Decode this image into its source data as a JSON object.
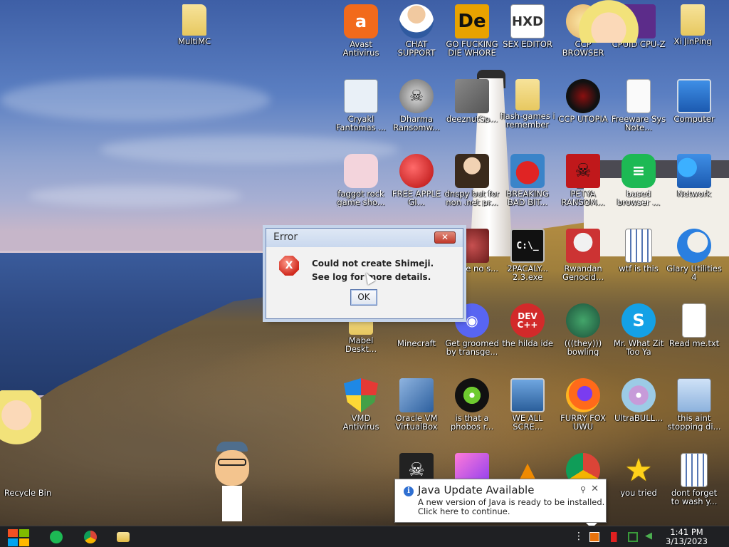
{
  "desktop": {
    "icons": [
      {
        "label": "MultiMC",
        "icon": "folder-icon"
      },
      {
        "label": "Avast Antivirus",
        "icon": "avast-icon"
      },
      {
        "label": "CHAT SUPPORT",
        "icon": "doctor-icon"
      },
      {
        "label": "GO FUCKING DIE WHORE",
        "icon": "dependency-walker-icon"
      },
      {
        "label": "SEX EDITOR",
        "icon": "hxd-icon"
      },
      {
        "label": "CCP BROWSER",
        "icon": "browser-icon"
      },
      {
        "label": "CPUID CPU-Z",
        "icon": "cpuz-icon"
      },
      {
        "label": "Xi JinPing",
        "icon": "user-folder-icon"
      },
      {
        "label": "Cryakl Fantomas ...",
        "icon": "window-icon"
      },
      {
        "label": "Dharma Ransomw...",
        "icon": "skull-icon"
      },
      {
        "label": "deeznutSp...",
        "icon": "stacked-windows-icon"
      },
      {
        "label": "flash-games i remember",
        "icon": "folder-icon"
      },
      {
        "label": "CCP UTOPIA",
        "icon": "dark-circle-icon"
      },
      {
        "label": "Freeware Sys Note...",
        "icon": "document-icon"
      },
      {
        "label": "Computer",
        "icon": "computer-icon"
      },
      {
        "label": "faggot rock game sho...",
        "icon": "pig-icon"
      },
      {
        "label": "FREE APPLE GI...",
        "icon": "apple-icon"
      },
      {
        "label": "dnspy but for non .net pr...",
        "icon": "portrait-icon"
      },
      {
        "label": "BREAKING BAD BIT...",
        "icon": "angry-bird-icon"
      },
      {
        "label": "PETYA RANSOM...",
        "icon": "petya-skull-icon"
      },
      {
        "label": "based browser ...",
        "icon": "chat-bubble-icon"
      },
      {
        "label": "Network",
        "icon": "network-icon"
      },
      {
        "label": "above no s...",
        "icon": "partial-icon"
      },
      {
        "label": "2PACALY... 2.3.exe",
        "icon": "console-icon"
      },
      {
        "label": "Rwandan Genocid...",
        "icon": "meme-icon"
      },
      {
        "label": "wtf is this",
        "icon": "calendar-doc-icon"
      },
      {
        "label": "Glary Utilities 4",
        "icon": "moon-icon"
      },
      {
        "label": "Mabel Deskt...",
        "icon": "folder-icon"
      },
      {
        "label": "Minecraft",
        "icon": "minecraft-icon"
      },
      {
        "label": "Get groomed by transge...",
        "icon": "discord-icon"
      },
      {
        "label": "the hilda ide",
        "icon": "devcpp-icon"
      },
      {
        "label": "(((they))) bowling",
        "icon": "bowling-icon"
      },
      {
        "label": "Mr. What Zit Too Ya",
        "icon": "skype-icon"
      },
      {
        "label": "Read me.txt",
        "icon": "text-file-icon"
      },
      {
        "label": "VMD Antivirus",
        "icon": "shield-icon"
      },
      {
        "label": "Oracle VM VirtualBox",
        "icon": "virtualbox-icon"
      },
      {
        "label": "is that a phobos r...",
        "icon": "icq-icon"
      },
      {
        "label": "WE ALL SCRE...",
        "icon": "pc-icon"
      },
      {
        "label": "FURRY FOX UWU",
        "icon": "firefox-icon"
      },
      {
        "label": "UltraBULL...",
        "icon": "disc-icon"
      },
      {
        "label": "this aint stopping di...",
        "icon": "monitor-icon"
      },
      {
        "label": "you tried",
        "icon": "star-icon"
      },
      {
        "label": "dont forget to wash y...",
        "icon": "calendar-doc-icon"
      },
      {
        "label": "Recycle Bin",
        "icon": "recycle-bin-icon"
      }
    ]
  },
  "error_dialog": {
    "title": "Error",
    "line1": "Could not create Shimeji.",
    "line2": "See log for more details.",
    "ok_label": "OK",
    "close_glyph": "✕",
    "icon_glyph": "X"
  },
  "java_notification": {
    "title": "Java Update Available",
    "line1": "A new version of Java is ready to be installed.",
    "line2": "Click here to continue.",
    "info_glyph": "i",
    "pin_glyph": "⚲",
    "close_glyph": "✕"
  },
  "taskbar": {
    "time": "1:41 PM",
    "date": "3/13/2023",
    "overflow_glyph": "⋮"
  }
}
